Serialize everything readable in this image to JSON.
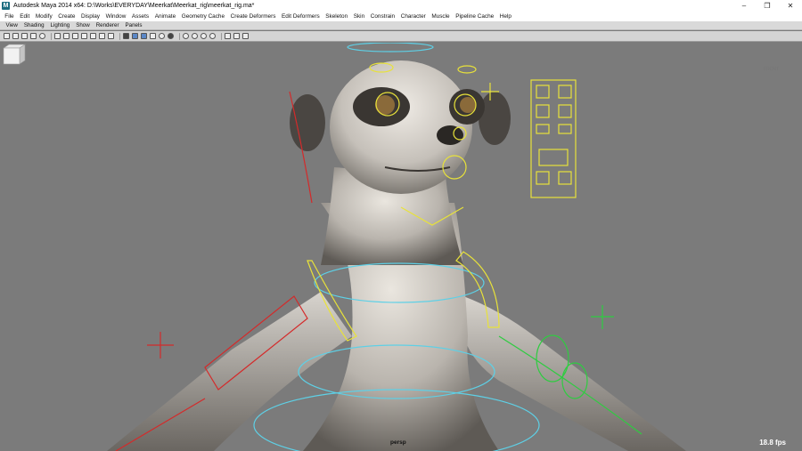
{
  "window": {
    "title": "Autodesk Maya 2014 x64: D:\\Works\\EVERYDAY\\Meerkat\\Meerkat_rig\\meerkat_rig.ma*",
    "app_icon": "M"
  },
  "window_controls": {
    "minimize": "–",
    "maximize": "❐",
    "close": "✕"
  },
  "menubar": [
    "File",
    "Edit",
    "Modify",
    "Create",
    "Display",
    "Window",
    "Assets",
    "Animate",
    "Geometry Cache",
    "Create Deformers",
    "Edit Deformers",
    "Skeleton",
    "Skin",
    "Constrain",
    "Character",
    "Muscle",
    "Pipeline Cache",
    "Help"
  ],
  "panel_menus": [
    "View",
    "Shading",
    "Lighting",
    "Show",
    "Renderer",
    "Panels"
  ],
  "viewport": {
    "camera": "persp",
    "fps": "18.8 fps",
    "viewcube_face": "FRONT"
  },
  "colors": {
    "viewport_bg": "#7b7b7b",
    "control_yellow": "#e8e23a",
    "control_cyan": "#5ed0e6",
    "control_red": "#d42a2a",
    "control_green": "#2ecc40"
  }
}
